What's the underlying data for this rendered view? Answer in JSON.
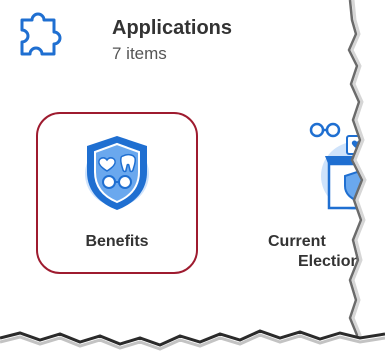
{
  "section": {
    "title": "Applications",
    "count_label": "7 items",
    "icon": "puzzle-piece-icon"
  },
  "apps": [
    {
      "label": "Benefits",
      "icon": "shield-benefits-icon",
      "selected": true
    },
    {
      "label_line1": "Current",
      "label_line2": "Election",
      "icon": "ballot-box-icon",
      "selected": false
    }
  ],
  "colors": {
    "accent_blue": "#1f6fd1",
    "light_blue": "#cfe3fb",
    "selection_border": "#9e1b2f",
    "text_dark": "#333333"
  }
}
